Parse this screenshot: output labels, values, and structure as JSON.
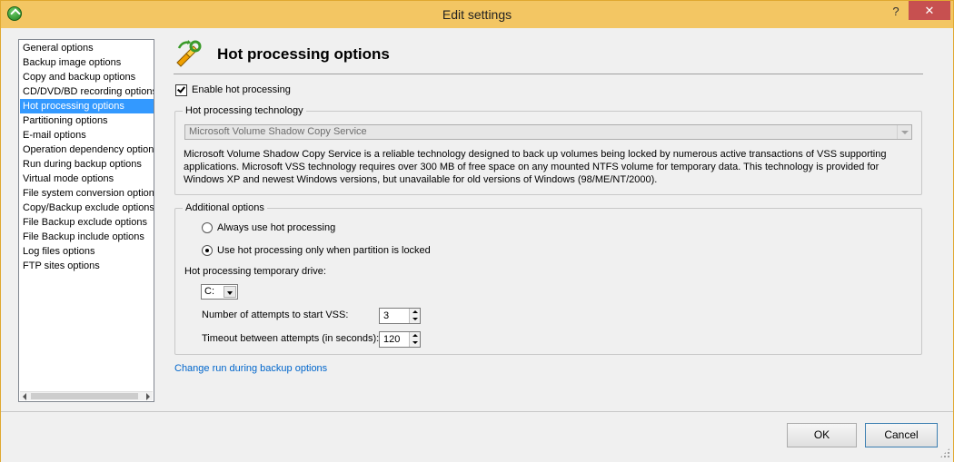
{
  "window": {
    "title": "Edit settings",
    "help_label": "?",
    "close_label": "✕"
  },
  "sidebar": {
    "items": [
      {
        "label": "General options",
        "selected": false
      },
      {
        "label": "Backup image options",
        "selected": false
      },
      {
        "label": "Copy and backup options",
        "selected": false
      },
      {
        "label": "CD/DVD/BD recording options",
        "selected": false
      },
      {
        "label": "Hot processing options",
        "selected": true
      },
      {
        "label": "Partitioning options",
        "selected": false
      },
      {
        "label": "E-mail options",
        "selected": false
      },
      {
        "label": "Operation dependency options",
        "selected": false
      },
      {
        "label": "Run during backup options",
        "selected": false
      },
      {
        "label": "Virtual mode options",
        "selected": false
      },
      {
        "label": "File system conversion options",
        "selected": false
      },
      {
        "label": "Copy/Backup exclude options",
        "selected": false
      },
      {
        "label": "File Backup exclude options",
        "selected": false
      },
      {
        "label": "File Backup include options",
        "selected": false
      },
      {
        "label": "Log files options",
        "selected": false
      },
      {
        "label": "FTP sites options",
        "selected": false
      }
    ]
  },
  "main": {
    "title": "Hot processing options",
    "enable_hot_processing": {
      "label": "Enable hot processing",
      "checked": true
    },
    "technology_group": {
      "legend": "Hot processing technology",
      "selected_value": "Microsoft Volume Shadow Copy Service",
      "description": "Microsoft Volume Shadow Copy Service is a reliable technology designed to back up volumes being locked by numerous active transactions of VSS supporting applications. Microsoft VSS technology requires over 300 MB of free space on any mounted NTFS volume for temporary data. This technology is provided for Windows XP and newest Windows versions, but unavailable for old versions of Windows (98/ME/NT/2000)."
    },
    "additional_group": {
      "legend": "Additional options",
      "radio_always": {
        "label": "Always use hot processing",
        "checked": false
      },
      "radio_locked": {
        "label": "Use hot processing only when partition is locked",
        "checked": true
      },
      "temp_drive_label": "Hot processing temporary drive:",
      "temp_drive_value": "C:",
      "attempts_label": "Number of attempts to start VSS:",
      "attempts_value": "3",
      "timeout_label": "Timeout between attempts (in seconds):",
      "timeout_value": "120"
    },
    "link_text": "Change run during backup options"
  },
  "footer": {
    "ok_label": "OK",
    "cancel_label": "Cancel"
  },
  "colors": {
    "titlebar": "#f3c663",
    "selection": "#3399ff",
    "close_button": "#c75050",
    "link": "#0066cc"
  }
}
